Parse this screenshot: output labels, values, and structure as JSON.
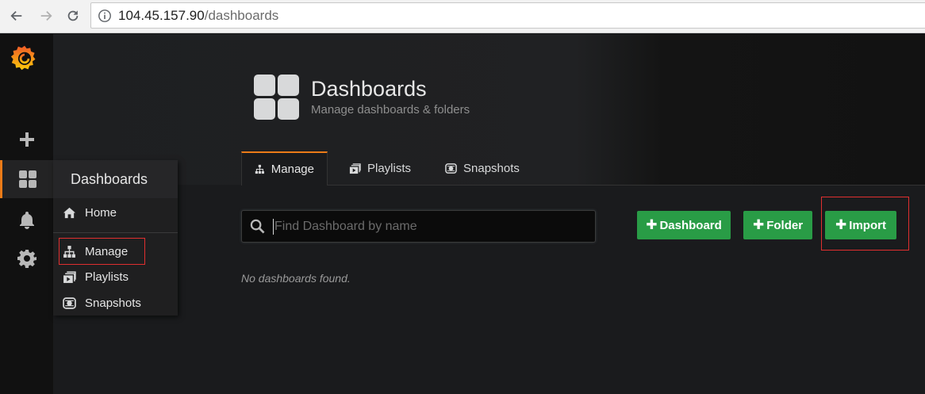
{
  "browser": {
    "url_host": "104.45.157.90",
    "url_path": "/dashboards"
  },
  "sidemenu": {
    "icons": [
      "grafana-logo-icon",
      "plus-icon",
      "dashboards-icon",
      "bell-icon",
      "gear-icon"
    ]
  },
  "flyout": {
    "title": "Dashboards",
    "items": [
      {
        "label": "Home",
        "icon": "home-icon"
      },
      {
        "label": "Manage",
        "icon": "sitemap-icon"
      },
      {
        "label": "Playlists",
        "icon": "playlists-icon"
      },
      {
        "label": "Snapshots",
        "icon": "snapshots-icon"
      }
    ]
  },
  "header": {
    "title": "Dashboards",
    "subtitle": "Manage dashboards & folders"
  },
  "tabs": [
    {
      "label": "Manage",
      "active": true
    },
    {
      "label": "Playlists",
      "active": false
    },
    {
      "label": "Snapshots",
      "active": false
    }
  ],
  "search": {
    "placeholder": "Find Dashboard by name",
    "value": ""
  },
  "buttons": {
    "dashboard": "Dashboard",
    "folder": "Folder",
    "import": "Import"
  },
  "empty_message": "No dashboards found.",
  "colors": {
    "accent": "#eb7b18",
    "success": "#299c46",
    "highlight": "#e02f2f"
  }
}
